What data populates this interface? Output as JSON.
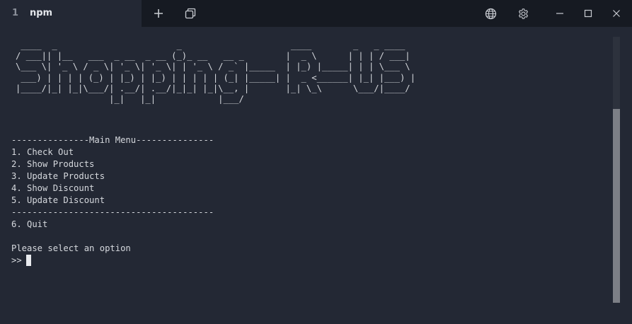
{
  "tab": {
    "index": "1",
    "title": "npm"
  },
  "toolbar": {
    "new_tab": "new-tab",
    "tabs_view": "tabs-view",
    "globe": "globe",
    "settings": "settings",
    "minimize": "minimize",
    "maximize": "maximize",
    "close": "close"
  },
  "terminal": {
    "banner": [
      " ____  _                       _                     ____        _   _ ____  ",
      "/ ___|| |__   ___  _ __  _ __ (_)_ __   __ _        |  _ \\      | | | / ___| ",
      "\\___ \\| '_ \\ / _ \\| '_ \\| '_ \\| | '_ \\ / _` |_____  | |_) |_____| | | \\___ \\ ",
      " ___) | | | | (_) | |_) | |_) | | | | | (_| |_____| |  _ <______| |_| |___) |",
      "|____/|_| |_|\\___/| .__/| .__/|_|_| |_|\\__, |       |_| \\_\\      \\___/|____/ ",
      "                  |_|   |_|            |___/                                 "
    ],
    "menu_header": "---------------Main Menu---------------",
    "options": [
      "1. Check Out",
      "2. Show Products",
      "3. Update Products",
      "4. Show Discount",
      "5. Update Discount"
    ],
    "separator": "---------------------------------------",
    "quit": "6. Quit",
    "prompt_text": "Please select an option",
    "prompt_symbol": ">>"
  },
  "colors": {
    "background": "#232834",
    "titlebar": "#161a22",
    "text": "#d6d9de",
    "scroll_thumb": "#7c7f86"
  }
}
